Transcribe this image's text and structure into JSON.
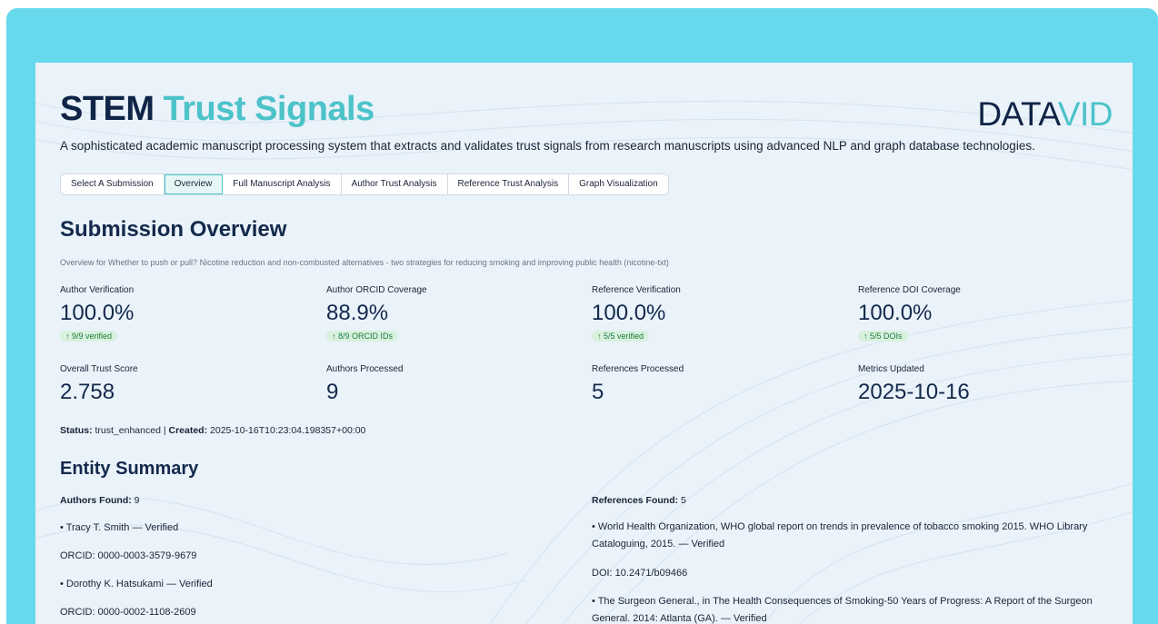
{
  "header": {
    "title_part1": "STEM",
    "title_part2": "Trust Signals",
    "logo_part1": "DATA",
    "logo_part2": "VID",
    "subtitle": "A sophisticated academic manuscript processing system that extracts and validates trust signals from research manuscripts using advanced NLP and graph database technologies."
  },
  "tabs": [
    {
      "label": "Select A Submission",
      "active": false
    },
    {
      "label": "Overview",
      "active": true
    },
    {
      "label": "Full Manuscript Analysis",
      "active": false
    },
    {
      "label": "Author Trust Analysis",
      "active": false
    },
    {
      "label": "Reference Trust Analysis",
      "active": false
    },
    {
      "label": "Graph Visualization",
      "active": false
    }
  ],
  "overview": {
    "heading": "Submission Overview",
    "description": "Overview for Whether to push or pull? Nicotine reduction and non-combusted alternatives - two strategies for reducing smoking and improving public health (nicotine-txt)",
    "metrics_row1": [
      {
        "label": "Author Verification",
        "value": "100.0%",
        "delta": "↑ 9/9 verified"
      },
      {
        "label": "Author ORCID Coverage",
        "value": "88.9%",
        "delta": "↑ 8/9 ORCID IDs"
      },
      {
        "label": "Reference Verification",
        "value": "100.0%",
        "delta": "↑ 5/5 verified"
      },
      {
        "label": "Reference DOI Coverage",
        "value": "100.0%",
        "delta": "↑ 5/5 DOIs"
      }
    ],
    "metrics_row2": [
      {
        "label": "Overall Trust Score",
        "value": "2.758"
      },
      {
        "label": "Authors Processed",
        "value": "9"
      },
      {
        "label": "References Processed",
        "value": "5"
      },
      {
        "label": "Metrics Updated",
        "value": "2025-10-16"
      }
    ],
    "status": {
      "status_label": "Status:",
      "status_value": "trust_enhanced",
      "separator": "|",
      "created_label": "Created:",
      "created_value": "2025-10-16T10:23:04.198357+00:00"
    }
  },
  "entity_summary": {
    "heading": "Entity Summary",
    "authors_label": "Authors Found:",
    "authors_count": "9",
    "authors": [
      {
        "line": "• Tracy T. Smith — Verified",
        "orcid": "ORCID: 0000-0003-3579-9679"
      },
      {
        "line": "• Dorothy K. Hatsukami — Verified",
        "orcid": "ORCID: 0000-0002-1108-2609"
      }
    ],
    "references_label": "References Found:",
    "references_count": "5",
    "references": [
      {
        "line": "• World Health Organization, WHO global report on trends in prevalence of tobacco smoking 2015. WHO Library Cataloguing, 2015. — Verified",
        "doi": "DOI: 10.2471/b09466"
      },
      {
        "line": "• The Surgeon General., in The Health Consequences of Smoking-50 Years of Progress: A Report of the Surgeon General. 2014: Atlanta (GA). — Verified"
      }
    ]
  },
  "colors": {
    "frame": "#67d9ec",
    "background": "#eaf2fa",
    "navy": "#13294b",
    "teal": "#4cc3c9",
    "delta_bg": "#d8f1de",
    "delta_text": "#1f7a3a"
  }
}
